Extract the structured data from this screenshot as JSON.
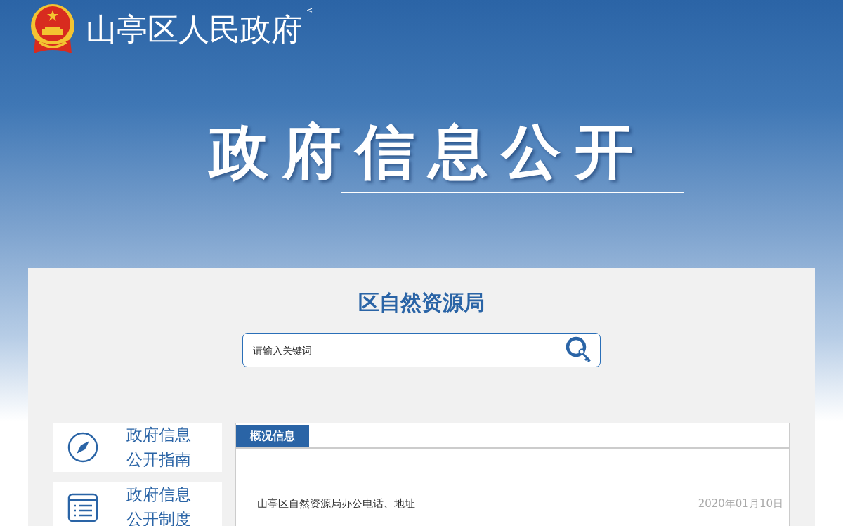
{
  "header": {
    "site_title": "山亭区人民政府",
    "collapse_glyph": "<",
    "banner_title": "政府信息公开"
  },
  "department": {
    "title": "区自然资源局"
  },
  "search": {
    "placeholder": "请输入关键词"
  },
  "sidebar": {
    "items": [
      {
        "label": "政府信息公开指南",
        "kind": "guide"
      },
      {
        "label": "政府信息公开制度",
        "kind": "rules"
      }
    ]
  },
  "info": {
    "tabs": [
      {
        "label": "概况信息",
        "selected": true
      }
    ],
    "rows": [
      {
        "title": "山亭区自然资源局办公电话、地址",
        "date": "2020年01月10日"
      }
    ]
  }
}
